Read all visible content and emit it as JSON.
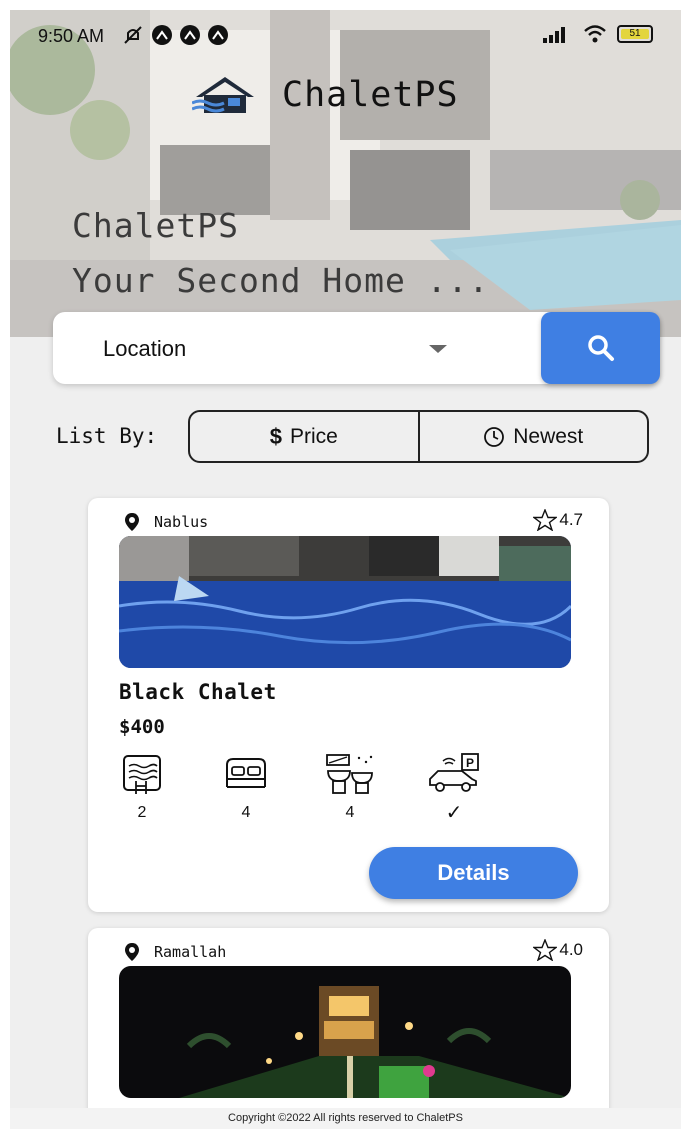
{
  "status_bar": {
    "time": "9:50 AM",
    "battery": "51",
    "icons": [
      "mute-icon",
      "notification-icon",
      "notification-icon",
      "notification-icon",
      "signal-icon",
      "wifi-icon",
      "battery-icon"
    ]
  },
  "header": {
    "brand": "ChaletPS",
    "tagline_line1": "ChaletPS",
    "tagline_line2": "Your Second Home ..."
  },
  "search": {
    "location_placeholder": "Location"
  },
  "list_by": {
    "label": "List By:",
    "price_label": "Price",
    "newest_label": "Newest"
  },
  "chalets": [
    {
      "city": "Nablus",
      "rating": "4.7",
      "name": "Black Chalet",
      "price": "$400",
      "pools": "2",
      "beds": "4",
      "bathrooms": "4",
      "parking": "✓",
      "details_label": "Details"
    },
    {
      "city": "Ramallah",
      "rating": "4.0"
    }
  ],
  "footer": {
    "copyright": "Copyright ©2022 All rights reserved to ChaletPS"
  },
  "colors": {
    "accent": "#3f7fe3",
    "background": "#efefef"
  }
}
